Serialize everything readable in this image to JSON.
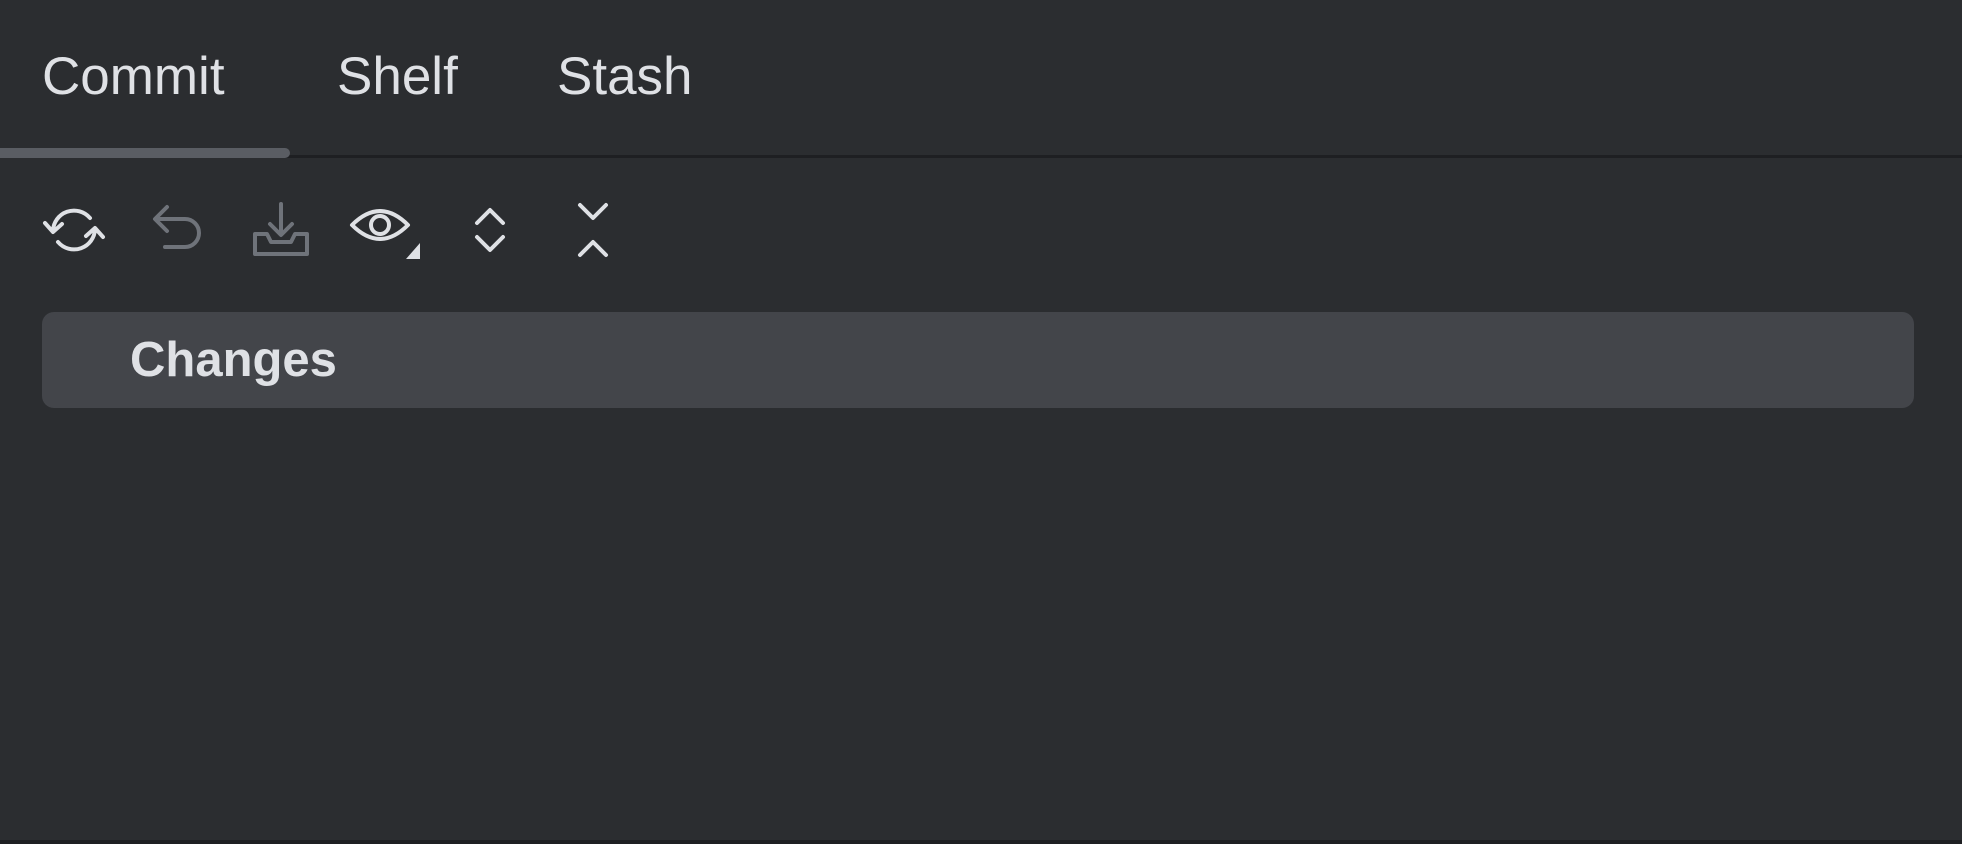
{
  "tabs": [
    {
      "label": "Commit",
      "selected": true
    },
    {
      "label": "Shelf",
      "selected": false
    },
    {
      "label": "Stash",
      "selected": false
    }
  ],
  "toolbar": {
    "icons": [
      "refresh-icon",
      "rollback-icon",
      "shelve-icon",
      "view-options-icon",
      "expand-all-icon",
      "collapse-all-icon"
    ],
    "enabled": [
      true,
      false,
      false,
      true,
      true,
      true
    ]
  },
  "changelist": {
    "label": "Changes"
  },
  "colors": {
    "background": "#2b2d30",
    "text": "#dfe1e5",
    "selected_row": "#43454a",
    "tab_indicator": "#5a5d63",
    "icon_enabled": "#dfe1e5",
    "icon_disabled": "#6f737a",
    "border": "#1e1f22"
  }
}
